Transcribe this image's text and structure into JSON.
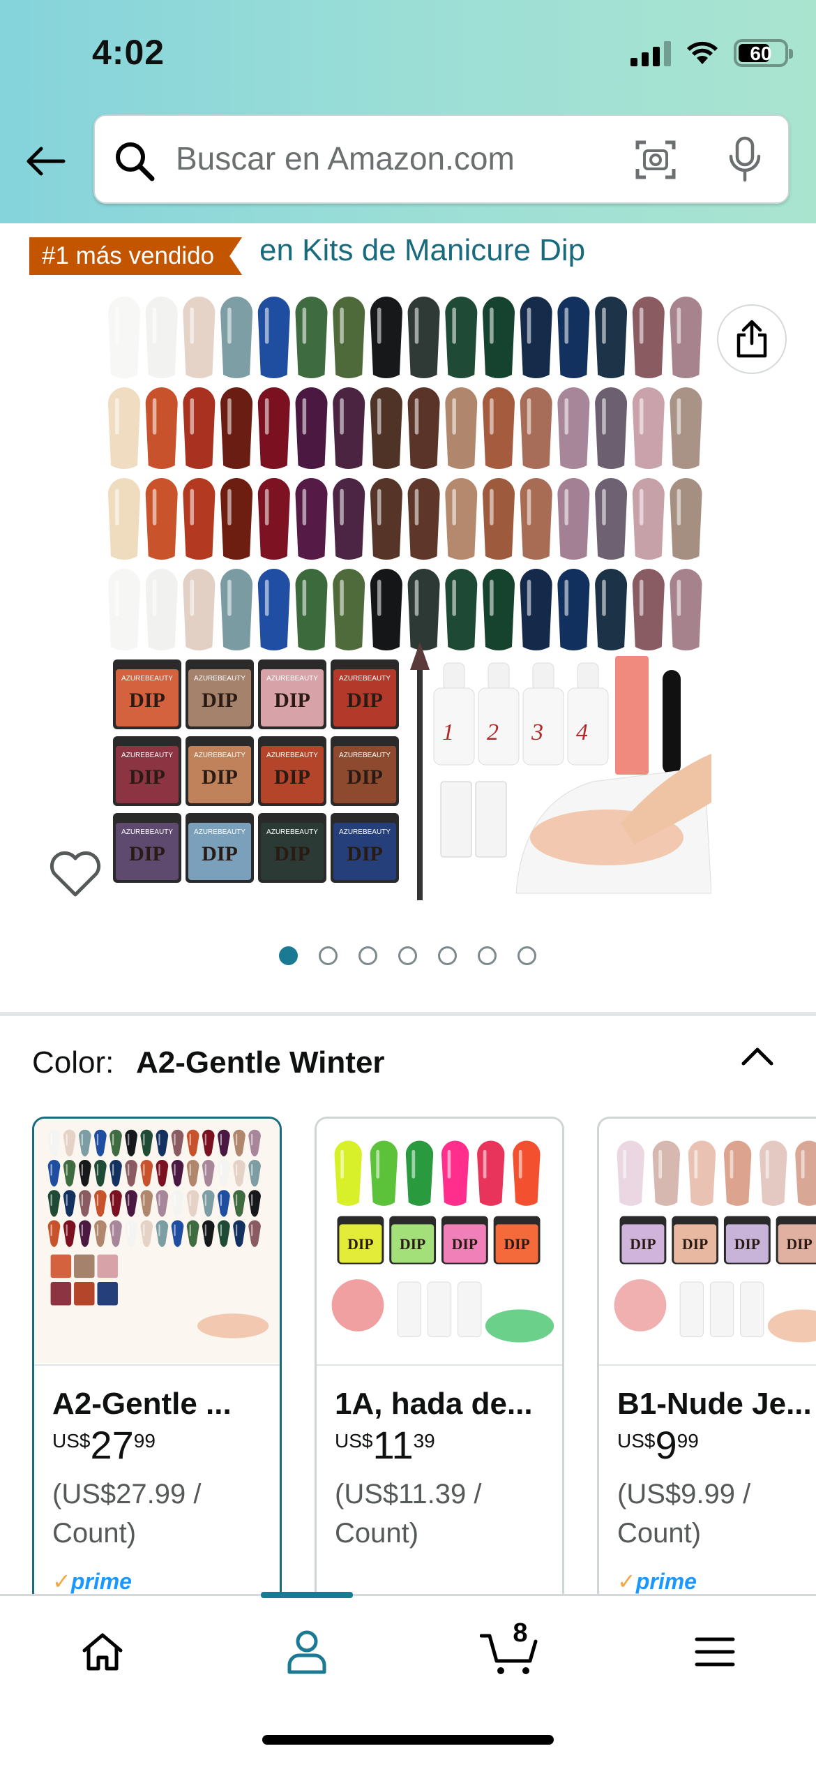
{
  "status_bar": {
    "time": "4:02",
    "battery_level": "60"
  },
  "search": {
    "placeholder": "Buscar en Amazon.com"
  },
  "best_seller": {
    "badge": "#1 más vendido",
    "category": "en Kits de Manicure Dip"
  },
  "product_image": {
    "brand_text": "AZUREBEAUTY",
    "jar_label": "DIP",
    "bottle_numbers": [
      "1",
      "2",
      "3",
      "4"
    ],
    "carousel_index": 0,
    "carousel_count": 7
  },
  "color_section": {
    "label": "Color:",
    "selected": "A2-Gentle Winter",
    "options": [
      {
        "name": "A2-Gentle ...",
        "currency": "US$",
        "whole": "27",
        "fraction": "99",
        "unit_price": "(US$27.99 / Count)",
        "prime": true,
        "selected": true
      },
      {
        "name": "1A, hada de...",
        "currency": "US$",
        "whole": "11",
        "fraction": "39",
        "unit_price": "(US$11.39 / Count)",
        "prime": false,
        "selected": false
      },
      {
        "name": "B1-Nude Je...",
        "currency": "US$",
        "whole": "9",
        "fraction": "99",
        "unit_price": "(US$9.99 / Count)",
        "prime": true,
        "selected": false
      }
    ],
    "prime_label": "prime"
  },
  "bottom_nav": {
    "cart_count": "8",
    "active_tab": "account"
  },
  "colors": {
    "accent": "#1a7a94",
    "badge": "#c45500",
    "link": "#1a6a7e",
    "prime_blue": "#1a98ff"
  }
}
